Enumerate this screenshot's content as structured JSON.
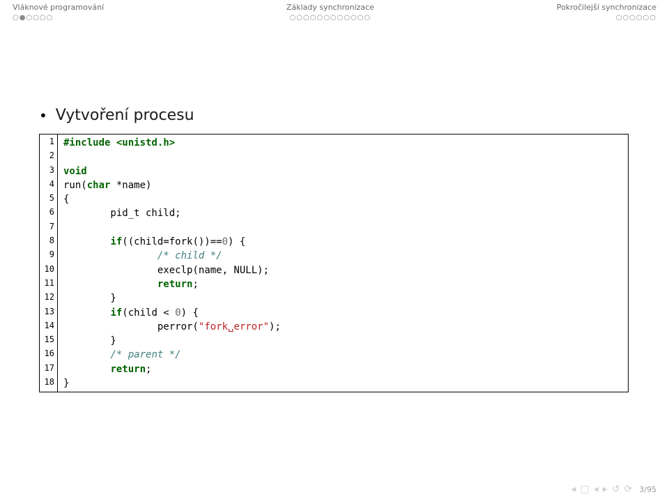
{
  "header": {
    "left": {
      "title": "Vláknové programování",
      "dots": "○●○○○○"
    },
    "center": {
      "title": "Základy synchronizace",
      "dots": "○○○○○○○○○○○○"
    },
    "right": {
      "title": "Pokročilejší synchronizace",
      "dots": "○○○○○○"
    }
  },
  "slide": {
    "bullet_icon": "•",
    "bullet_text": "Vytvoření procesu"
  },
  "code": {
    "lines": [
      {
        "n": "1",
        "seg": [
          [
            "kw",
            "#include <unistd.h>"
          ]
        ]
      },
      {
        "n": "2",
        "seg": []
      },
      {
        "n": "3",
        "seg": [
          [
            "kw",
            "void"
          ]
        ]
      },
      {
        "n": "4",
        "seg": [
          [
            "",
            "run("
          ],
          [
            "kw",
            "char"
          ],
          [
            "",
            " *name)"
          ]
        ]
      },
      {
        "n": "5",
        "seg": [
          [
            "",
            "{"
          ]
        ]
      },
      {
        "n": "6",
        "seg": [
          [
            "",
            "        pid_t child;"
          ]
        ]
      },
      {
        "n": "7",
        "seg": []
      },
      {
        "n": "8",
        "seg": [
          [
            "",
            "        "
          ],
          [
            "kw",
            "if"
          ],
          [
            "",
            "((child=fork())=="
          ],
          [
            "num",
            "0"
          ],
          [
            "",
            ") {"
          ]
        ]
      },
      {
        "n": "9",
        "seg": [
          [
            "",
            "                "
          ],
          [
            "cm",
            "/* child */"
          ]
        ]
      },
      {
        "n": "10",
        "seg": [
          [
            "",
            "                execlp(name, NULL);"
          ]
        ]
      },
      {
        "n": "11",
        "seg": [
          [
            "",
            "                "
          ],
          [
            "kw",
            "return"
          ],
          [
            "",
            ";"
          ]
        ]
      },
      {
        "n": "12",
        "seg": [
          [
            "",
            "        }"
          ]
        ]
      },
      {
        "n": "13",
        "seg": [
          [
            "",
            "        "
          ],
          [
            "kw",
            "if"
          ],
          [
            "",
            "(child < "
          ],
          [
            "num",
            "0"
          ],
          [
            "",
            ") {"
          ]
        ]
      },
      {
        "n": "14",
        "seg": [
          [
            "",
            "                perror("
          ],
          [
            "str",
            "\"fork␣error\""
          ],
          [
            "",
            ");"
          ]
        ]
      },
      {
        "n": "15",
        "seg": [
          [
            "",
            "        }"
          ]
        ]
      },
      {
        "n": "16",
        "seg": [
          [
            "",
            "        "
          ],
          [
            "cm",
            "/* parent */"
          ]
        ]
      },
      {
        "n": "17",
        "seg": [
          [
            "",
            "        "
          ],
          [
            "kw",
            "return"
          ],
          [
            "",
            ";"
          ]
        ]
      },
      {
        "n": "18",
        "seg": [
          [
            "",
            "}"
          ]
        ]
      }
    ]
  },
  "footer": {
    "icons": [
      "◂",
      "▢",
      "◂",
      "▸",
      "↺",
      "⟳"
    ],
    "page": "3/95"
  }
}
